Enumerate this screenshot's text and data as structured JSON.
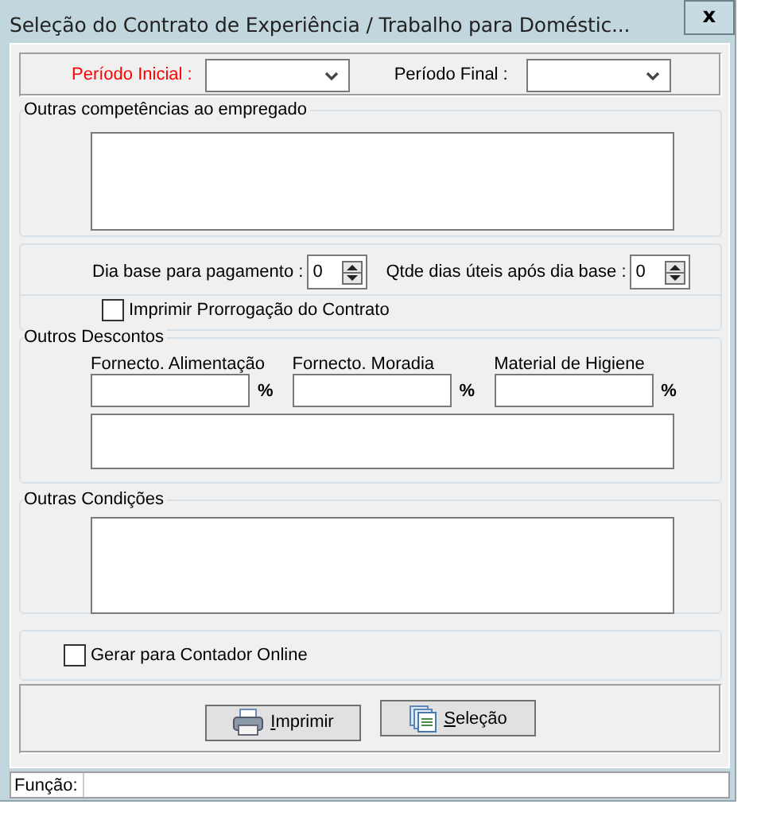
{
  "window": {
    "title": "Seleção do Contrato de Experiência / Trabalho para Doméstic...",
    "close_label": "x"
  },
  "period_fields": [
    {
      "label": "Período Inicial :",
      "required": true
    },
    {
      "label": "Período Final :",
      "required": false
    }
  ],
  "competencias": {
    "title": "Outras competências ao empregado"
  },
  "spinners": [
    {
      "label": "Dia base para pagamento :",
      "value": "0"
    },
    {
      "label": "Qtde dias úteis após dia base :",
      "value": "0"
    }
  ],
  "prorrogacao": {
    "label": "Imprimir Prorrogação do Contrato",
    "checked": false
  },
  "descontos": {
    "title": "Outros Descontos",
    "fields": [
      {
        "label": "Fornecto. Alimentação",
        "unit": "%"
      },
      {
        "label": "Fornecto. Moradia",
        "unit": "%"
      },
      {
        "label": "Material de Higiene",
        "unit": "%"
      }
    ]
  },
  "condicoes": {
    "title": "Outras Condições"
  },
  "contador": {
    "label": "Gerar para Contador Online",
    "checked": false
  },
  "buttons": [
    {
      "kind": "print",
      "label": "Imprimir"
    },
    {
      "kind": "selection",
      "label": "Seleção"
    }
  ],
  "status_bar": {
    "label": "Função:"
  }
}
